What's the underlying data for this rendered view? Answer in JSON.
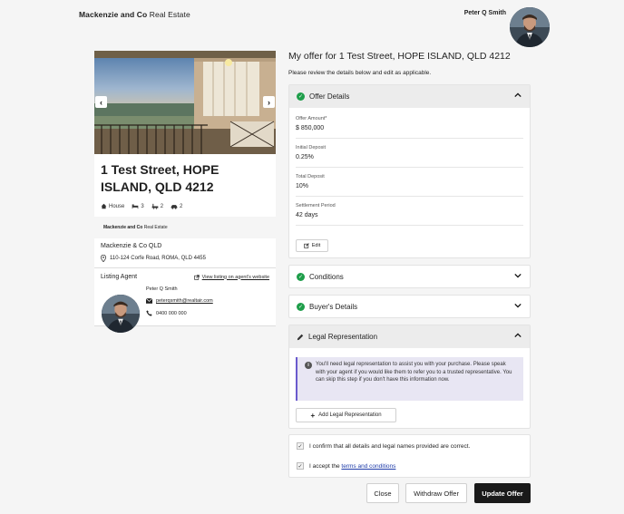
{
  "header": {
    "logo_bold": "Mackenzie and Co",
    "logo_rest": " Real Estate",
    "user_name": "Peter Q Smith"
  },
  "property": {
    "title": "1 Test Street, HOPE ISLAND, QLD 4212",
    "type": "House",
    "bedrooms": "3",
    "bathrooms": "2",
    "cars": "2",
    "brand_bold": "Mackenzie and Co",
    "brand_rest": " Real Estate"
  },
  "agency": {
    "name": "Mackenzie & Co QLD",
    "address": "110-124 Corfe Road, ROMA, QLD 4455"
  },
  "agent": {
    "section_label": "Listing Agent",
    "view_link": "View listing on agent's website",
    "name": "Peter Q Smith",
    "email": "peterqsmith@realtair.com",
    "phone": "0400 000 000"
  },
  "offer": {
    "title": "My offer for 1 Test Street, HOPE ISLAND, QLD 4212",
    "subtitle": "Please review the details below and edit as applicable.",
    "details_title": "Offer Details",
    "fields": [
      {
        "label": "Offer Amount*",
        "value": "$ 850,000"
      },
      {
        "label": "Initial Deposit",
        "value": "0.25%"
      },
      {
        "label": "Total Deposit",
        "value": "10%"
      },
      {
        "label": "Settlement Period",
        "value": "42 days"
      }
    ],
    "edit_label": "Edit"
  },
  "sections": {
    "conditions": "Conditions",
    "buyers": "Buyer's Details",
    "legal": "Legal Representation",
    "legal_info": "You'll need legal representation to assist you with your purchase. Please speak with your agent if you would like them to refer you to a trusted representative. You can skip this step if you don't have this information now.",
    "add_legal": "Add Legal Representation"
  },
  "confirm": {
    "line1": "I confirm that all details and legal names provided are correct.",
    "line2_prefix": "I accept the ",
    "line2_link": "terms and conditions"
  },
  "actions": {
    "close": "Close",
    "withdraw": "Withdraw Offer",
    "update": "Update Offer"
  },
  "colors": {
    "accent_green": "#1e9e4a",
    "info_bg": "#e8e6f3",
    "primary_button": "#1a1a1a",
    "link": "#1d3ba8"
  }
}
